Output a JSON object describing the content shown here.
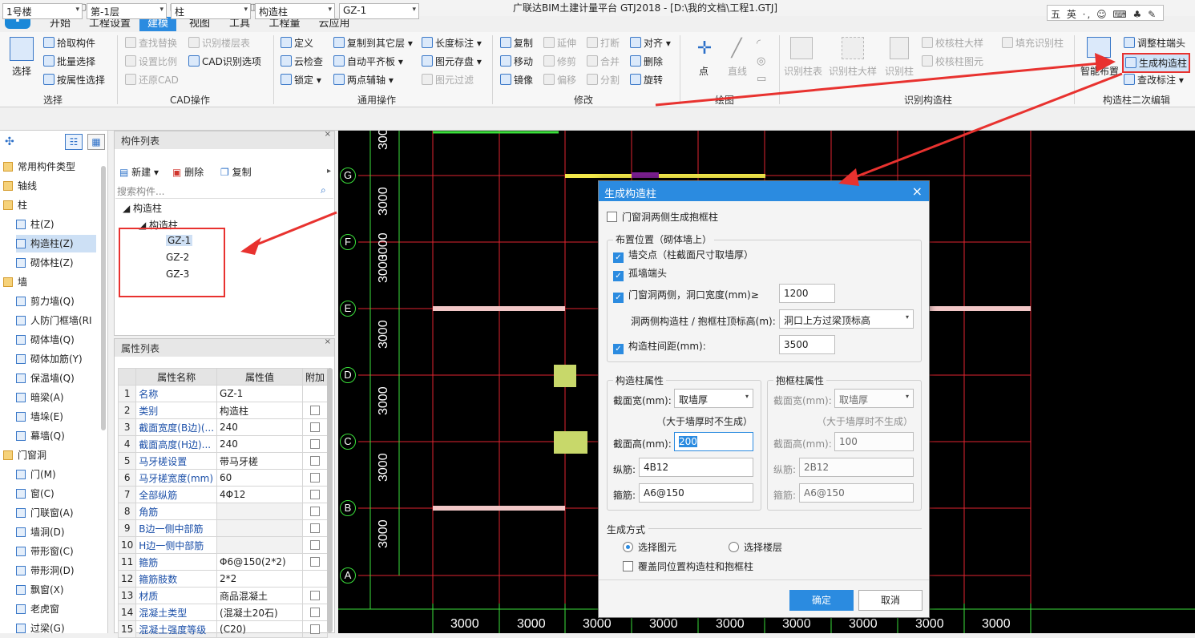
{
  "window": {
    "title": "广联达BIM土建计量平台 GTJ2018 - [D:\\我的文档\\工程1.GTJ]",
    "logo": "T",
    "ime": "五 英 ·, ☺ ⌨ ♣ ✎"
  },
  "menu_tabs": [
    "开始",
    "工程设置",
    "建模",
    "视图",
    "工具",
    "工程量",
    "云应用"
  ],
  "ribbon": {
    "select_label": "选择",
    "group_select": {
      "items": [
        "拾取构件",
        "批量选择",
        "按属性选择"
      ],
      "label": "选择"
    },
    "group_cad": {
      "items": [
        "查找替换",
        "识别楼层表",
        "设置比例",
        "CAD识别选项",
        "还原CAD"
      ],
      "label": "CAD操作"
    },
    "group_general": {
      "items": [
        "定义",
        "复制到其它层",
        "长度标注",
        "云检查",
        "自动平齐板",
        "图元存盘",
        "锁定",
        "两点辅轴",
        "图元过滤"
      ],
      "label": "通用操作"
    },
    "group_modify": {
      "items": [
        "复制",
        "延伸",
        "打断",
        "对齐",
        "移动",
        "修剪",
        "合并",
        "删除",
        "镜像",
        "偏移",
        "分割",
        "旋转"
      ],
      "label": "修改"
    },
    "group_draw": {
      "items": [
        "点",
        "直线"
      ],
      "label": "绘图"
    },
    "group_recognize": {
      "items": [
        "识别柱表",
        "识别柱大样",
        "识别柱",
        "校核柱大样",
        "填充识别柱",
        "校核柱图元"
      ],
      "label": "识别构造柱"
    },
    "group_secondary": {
      "items": [
        "智能布置",
        "调整柱端头",
        "生成构造柱",
        "查改标注"
      ],
      "label": "构造柱二次编辑"
    }
  },
  "selectors": {
    "building": "1号楼",
    "floor": "第-1层",
    "type": "柱",
    "subtype": "构造柱",
    "component": "GZ-1"
  },
  "nav": {
    "items": [
      {
        "label": "常用构件类型",
        "cat": true
      },
      {
        "label": "轴线",
        "cat": true
      },
      {
        "label": "柱",
        "cat": true
      },
      {
        "label": "柱(Z)"
      },
      {
        "label": "构造柱(Z)",
        "sel": true
      },
      {
        "label": "砌体柱(Z)"
      },
      {
        "label": "墙",
        "cat": true
      },
      {
        "label": "剪力墙(Q)"
      },
      {
        "label": "人防门框墙(RI"
      },
      {
        "label": "砌体墙(Q)"
      },
      {
        "label": "砌体加筋(Y)"
      },
      {
        "label": "保温墙(Q)"
      },
      {
        "label": "暗梁(A)"
      },
      {
        "label": "墙垛(E)"
      },
      {
        "label": "幕墙(Q)"
      },
      {
        "label": "门窗洞",
        "cat": true
      },
      {
        "label": "门(M)"
      },
      {
        "label": "窗(C)"
      },
      {
        "label": "门联窗(A)"
      },
      {
        "label": "墙洞(D)"
      },
      {
        "label": "带形窗(C)"
      },
      {
        "label": "带形洞(D)"
      },
      {
        "label": "飘窗(X)"
      },
      {
        "label": "老虎窗"
      },
      {
        "label": "过梁(G)"
      }
    ]
  },
  "component_list": {
    "title": "构件列表",
    "new": "新建",
    "delete": "删除",
    "copy": "复制",
    "search_placeholder": "搜索构件...",
    "root": "构造柱",
    "sub": "构造柱",
    "items": [
      "GZ-1",
      "GZ-2",
      "GZ-3"
    ]
  },
  "property_list": {
    "title": "属性列表",
    "headers": [
      "属性名称",
      "属性值",
      "附加"
    ],
    "rows": [
      {
        "idx": "1",
        "name": "名称",
        "value": "GZ-1",
        "chk": false
      },
      {
        "idx": "2",
        "name": "类别",
        "value": "构造柱",
        "chk": true
      },
      {
        "idx": "3",
        "name": "截面宽度(B边)(...",
        "value": "240",
        "chk": true
      },
      {
        "idx": "4",
        "name": "截面高度(H边)...",
        "value": "240",
        "chk": true
      },
      {
        "idx": "5",
        "name": "马牙槎设置",
        "value": "带马牙槎",
        "chk": true
      },
      {
        "idx": "6",
        "name": "马牙槎宽度(mm)",
        "value": "60",
        "chk": true
      },
      {
        "idx": "7",
        "name": "全部纵筋",
        "value": "4Φ12",
        "chk": true
      },
      {
        "idx": "8",
        "name": "角筋",
        "value": "",
        "chk": true
      },
      {
        "idx": "9",
        "name": "B边一侧中部筋",
        "value": "",
        "chk": true
      },
      {
        "idx": "10",
        "name": "H边一侧中部筋",
        "value": "",
        "chk": true
      },
      {
        "idx": "11",
        "name": "箍筋",
        "value": "Φ6@150(2*2)",
        "chk": true
      },
      {
        "idx": "12",
        "name": "箍筋肢数",
        "value": "2*2",
        "chk": false
      },
      {
        "idx": "13",
        "name": "材质",
        "value": "商品混凝土",
        "chk": true
      },
      {
        "idx": "14",
        "name": "混凝土类型",
        "value": "(混凝土20石)",
        "chk": true
      },
      {
        "idx": "15",
        "name": "混凝土强度等级",
        "value": "(C20)",
        "chk": true
      }
    ]
  },
  "canvas": {
    "row_axes": [
      "G",
      "F",
      "E",
      "D",
      "C",
      "B",
      "A"
    ],
    "row_dims": [
      "3000",
      "3000",
      "3000",
      "3000",
      "3000",
      "3000",
      "3000",
      "3000"
    ],
    "col_dims": [
      "3000",
      "3000",
      "3000",
      "3000",
      "3000",
      "3000",
      "3000",
      "3000",
      "3000"
    ],
    "colors": {
      "grid": "#e0242f",
      "axis": "#3be03b",
      "wall": "#f2c7c7",
      "column": "#c8d86a",
      "highlight": "#f2e84a",
      "annotation": "#e8322f"
    }
  },
  "dialog": {
    "title": "生成构造柱",
    "close": "×",
    "frame_column_opt": "门窗洞两侧生成抱框柱",
    "position_legend": "布置位置（砌体墙上）",
    "wall_intersection": "墙交点（柱截面尺寸取墙厚）",
    "isolated_wall_end": "孤墙端头",
    "opening_sides": "门窗洞两侧，洞口宽度(mm)≥",
    "opening_width": "1200",
    "top_elev_label": "洞两侧构造柱 / 抱框柱顶标高(m):",
    "top_elev_value": "洞口上方过梁顶标高",
    "spacing_label": "构造柱间距(mm):",
    "spacing_value": "3500",
    "gz_legend": "构造柱属性",
    "bk_legend": "抱框柱属性",
    "section_width_label": "截面宽(mm):",
    "section_width_value": "取墙厚",
    "not_generate_note": "（大于墙厚时不生成）",
    "section_height_label": "截面高(mm):",
    "gz_section_height": "200",
    "bk_section_height": "100",
    "long_bar_label": "纵筋:",
    "gz_long_bar": "4B12",
    "bk_long_bar": "2B12",
    "stirrup_label": "箍筋:",
    "gz_stirrup": "A6@150",
    "bk_stirrup": "A6@150",
    "mode_legend": "生成方式",
    "mode_select_element": "选择图元",
    "mode_select_floor": "选择楼层",
    "overwrite": "覆盖同位置构造柱和抱框柱",
    "ok": "确定",
    "cancel": "取消"
  }
}
